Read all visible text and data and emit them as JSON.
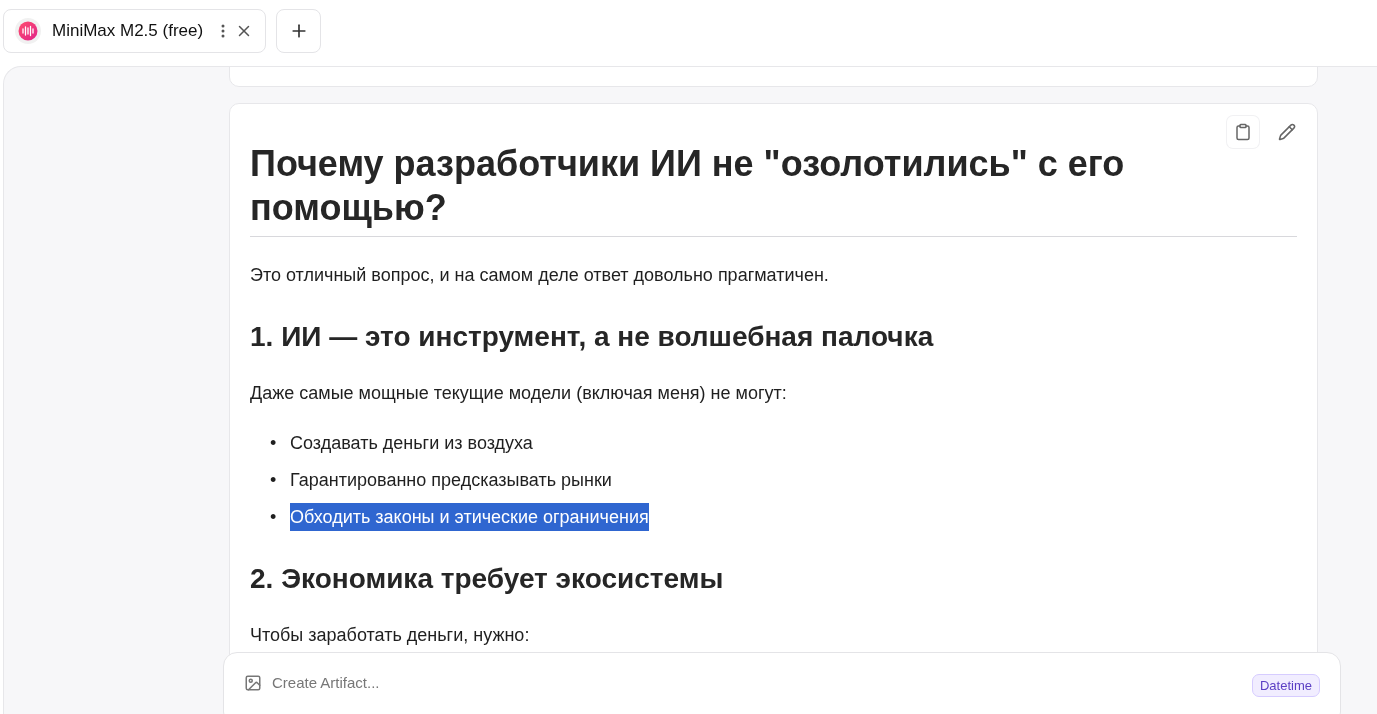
{
  "tabs": [
    {
      "label": "MiniMax M2.5 (free)"
    }
  ],
  "message": {
    "title": "Почему разработчики ИИ не \"озолотились\" с его помощью?",
    "bullet": "•",
    "blocks": [
      {
        "kind": "paragraph",
        "text": "Это отличный вопрос, и на самом деле ответ довольно прагматичен."
      },
      {
        "kind": "heading",
        "text": "1. ИИ — это инструмент, а не волшебная палочка"
      },
      {
        "kind": "paragraph",
        "text": "Даже самые мощные текущие модели (включая меня) не могут:"
      },
      {
        "kind": "list",
        "items": [
          {
            "text": "Создавать деньги из воздуха",
            "selected": false
          },
          {
            "text": "Гарантированно предсказывать рынки",
            "selected": false
          },
          {
            "text": "Обходить законы и этические ограничения",
            "selected": true
          }
        ]
      },
      {
        "kind": "heading",
        "text": "2. Экономика требует экосистемы"
      },
      {
        "kind": "paragraph",
        "text": "Чтобы заработать деньги, нужно:"
      }
    ]
  },
  "composer": {
    "placeholder": "Create Artifact...",
    "tag": "Datetime"
  }
}
